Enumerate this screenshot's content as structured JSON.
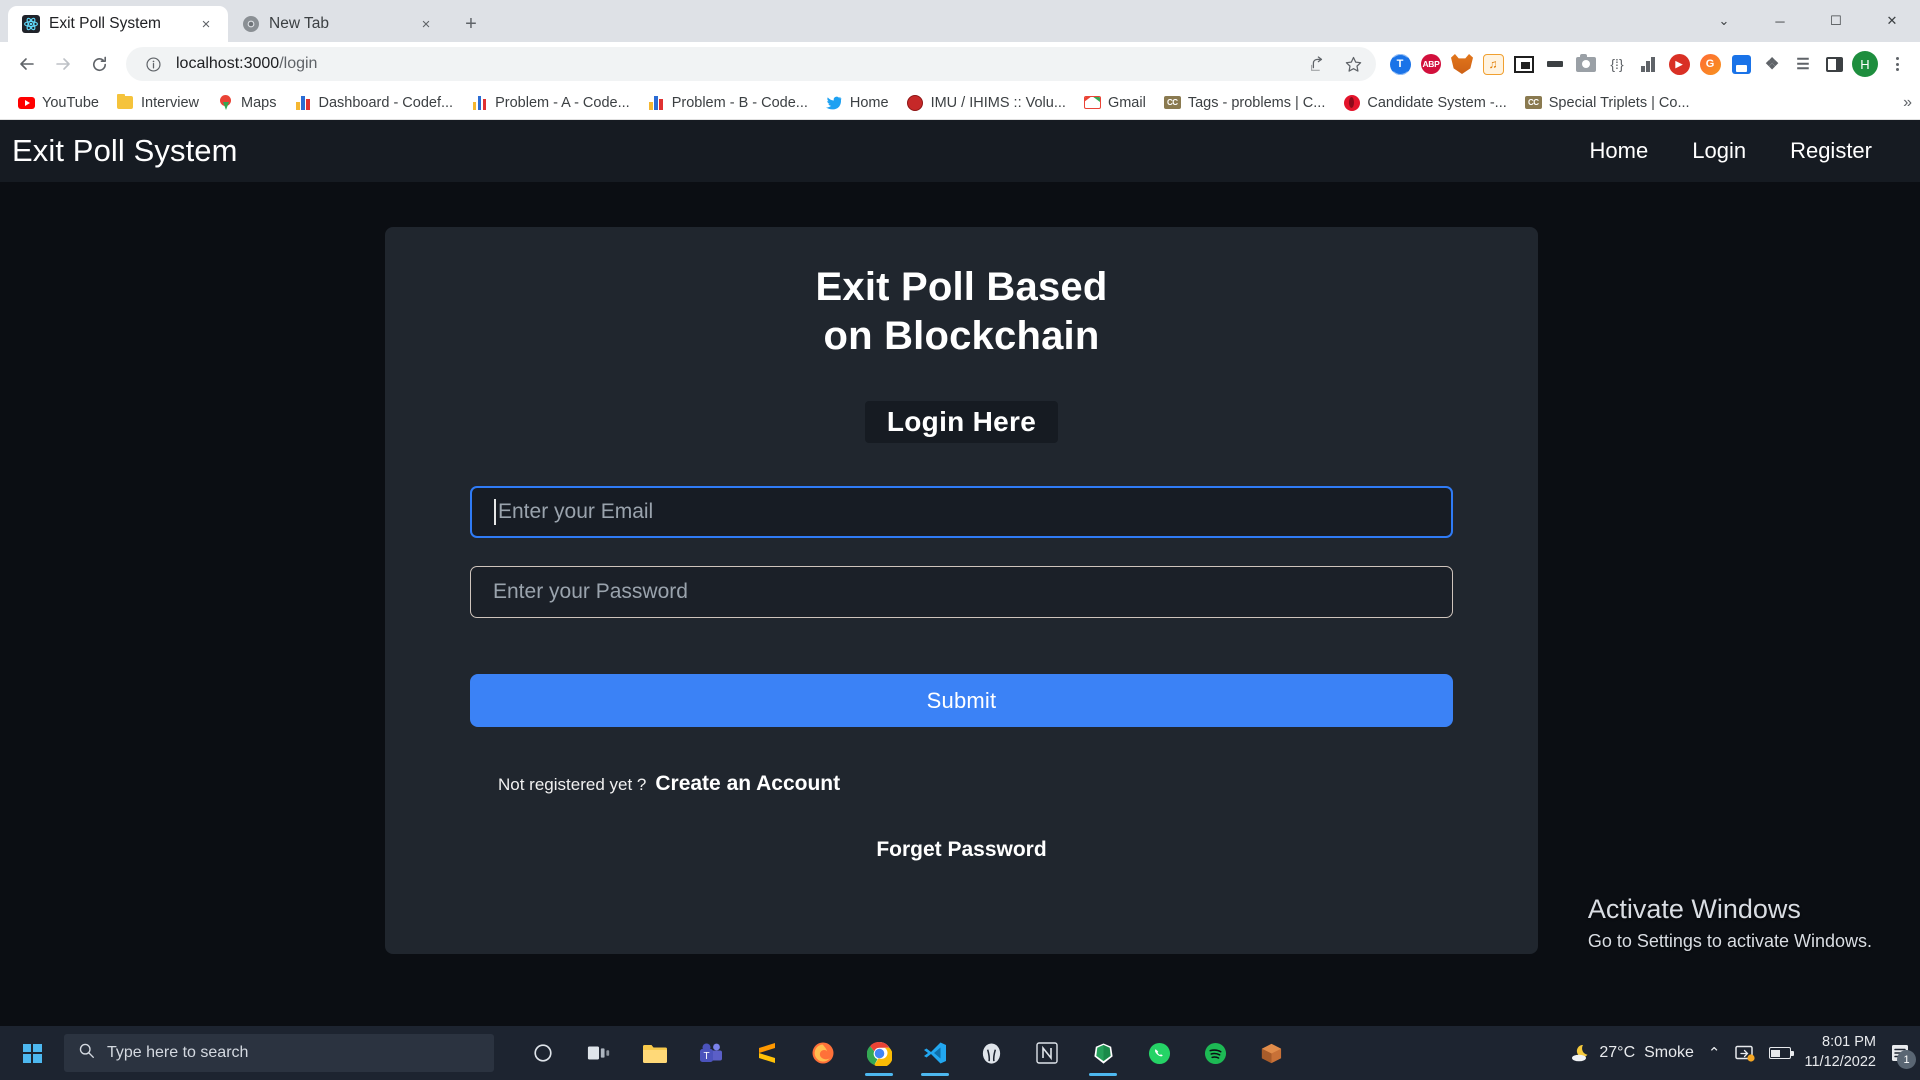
{
  "browser": {
    "tabs": [
      {
        "title": "Exit Poll System",
        "icon": "react-icon",
        "active": true,
        "close_label": "×"
      },
      {
        "title": "New Tab",
        "icon": "chrome-icon",
        "active": false,
        "close_label": "×"
      }
    ],
    "new_tab_label": "+",
    "window_controls": {
      "collapse": "⌄",
      "minimize": "─",
      "maximize": "☐",
      "close": "✕"
    },
    "nav": {
      "back": "←",
      "forward": "→",
      "reload": "⟳"
    },
    "omnibox": {
      "host": "localhost:3000",
      "path": "/login",
      "full_url": "localhost:3000/login",
      "info_icon": "info-circle-icon",
      "share_icon": "share-icon",
      "bookmark_icon": "star-icon"
    },
    "extensions": [
      {
        "name": "tampermonkey-icon",
        "label": "T"
      },
      {
        "name": "adblock-plus-icon",
        "label": "ABP"
      },
      {
        "name": "metamask-fox-icon",
        "label": ""
      },
      {
        "name": "honey-icon",
        "label": "♫"
      },
      {
        "name": "picture-in-picture-icon",
        "label": ""
      },
      {
        "name": "dark-reader-icon",
        "label": ""
      },
      {
        "name": "screenshot-camera-icon",
        "label": ""
      },
      {
        "name": "json-viewer-icon",
        "label": "{⁞}"
      },
      {
        "name": "analytics-chart-icon",
        "label": ""
      },
      {
        "name": "video-download-icon",
        "label": "▶"
      },
      {
        "name": "grammarly-icon",
        "label": "G"
      },
      {
        "name": "save-session-icon",
        "label": ""
      },
      {
        "name": "extensions-puzzle-icon",
        "label": "❖"
      },
      {
        "name": "reading-list-icon",
        "label": "☰"
      },
      {
        "name": "side-panel-icon",
        "label": ""
      }
    ],
    "profile": {
      "initial": "H"
    },
    "menu_label": "⋮",
    "bookmarks": [
      {
        "label": "YouTube",
        "icon": "youtube-icon"
      },
      {
        "label": "Interview",
        "icon": "folder-icon"
      },
      {
        "label": "Maps",
        "icon": "maps-pin-icon"
      },
      {
        "label": "Dashboard - Codef...",
        "icon": "bar-chart-icon"
      },
      {
        "label": "Problem - A - Code...",
        "icon": "bar-chart-icon"
      },
      {
        "label": "Problem - B - Code...",
        "icon": "bar-chart-icon"
      },
      {
        "label": "Home",
        "icon": "twitter-icon"
      },
      {
        "label": "IMU / IHIMS :: Volu...",
        "icon": "seal-icon"
      },
      {
        "label": "Gmail",
        "icon": "gmail-icon"
      },
      {
        "label": "Tags - problems | C...",
        "icon": "cc-icon"
      },
      {
        "label": "Candidate System -...",
        "icon": "opera-icon"
      },
      {
        "label": "Special Triplets | Co...",
        "icon": "cc-icon"
      }
    ],
    "bookmarks_overflow": "»"
  },
  "site": {
    "brand": "Exit Poll System",
    "nav": [
      {
        "label": "Home"
      },
      {
        "label": "Login"
      },
      {
        "label": "Register"
      }
    ]
  },
  "login_card": {
    "title_line1": "Exit Poll Based",
    "title_line2": "on Blockchain",
    "badge": "Login Here",
    "email": {
      "placeholder": "Enter your Email",
      "value": "",
      "focused": true
    },
    "password": {
      "placeholder": "Enter your Password",
      "value": "",
      "focused": false
    },
    "submit_label": "Submit",
    "register_prompt": "Not registered yet ?",
    "register_link": "Create an Account",
    "forget_link": "Forget Password",
    "accent_color": "#3b82f6",
    "card_bg": "#20262e",
    "focus_border": "#2f7bf6"
  },
  "activation_watermark": {
    "line1": "Activate Windows",
    "line2": "Go to Settings to activate Windows."
  },
  "taskbar": {
    "start_icon": "windows-start-icon",
    "search_placeholder": "Type here to search",
    "search_icon": "search-icon",
    "apps": [
      {
        "name": "cortana-icon",
        "label": "○"
      },
      {
        "name": "task-view-icon",
        "label": ""
      },
      {
        "name": "file-explorer-icon",
        "label": ""
      },
      {
        "name": "microsoft-teams-icon",
        "label": ""
      },
      {
        "name": "sublime-text-icon",
        "label": "S"
      },
      {
        "name": "firefox-icon",
        "label": ""
      },
      {
        "name": "google-chrome-icon",
        "label": "",
        "active": true
      },
      {
        "name": "vs-code-icon",
        "label": "",
        "active": true
      },
      {
        "name": "postgresql-icon",
        "label": ""
      },
      {
        "name": "notion-icon",
        "label": "N"
      },
      {
        "name": "brave-browser-icon",
        "label": "",
        "active": true
      },
      {
        "name": "whatsapp-icon",
        "label": ""
      },
      {
        "name": "spotify-icon",
        "label": ""
      },
      {
        "name": "package-box-icon",
        "label": ""
      }
    ],
    "tray": {
      "weather_icon": "moon-cloud-icon",
      "temperature": "27°C",
      "condition": "Smoke",
      "chevron": "⌃",
      "network_icon": "network-icon",
      "battery_icon": "battery-icon",
      "time": "8:01 PM",
      "date": "11/12/2022",
      "notification_icon": "notification-icon",
      "notification_count": "1"
    }
  }
}
